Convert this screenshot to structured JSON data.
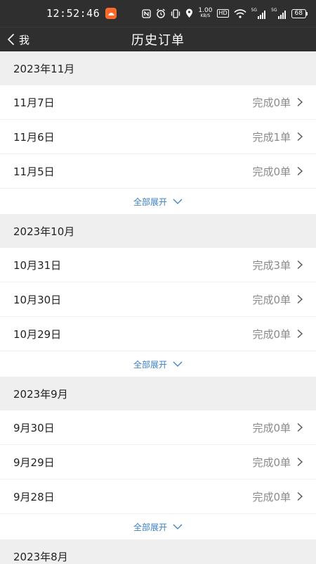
{
  "status_bar": {
    "time": "12:52:46",
    "net_speed_value": "1.00",
    "net_speed_unit": "KB/S",
    "hd_label": "HD",
    "sim1_label": "5G",
    "sim2_label": "5G",
    "battery": "68",
    "icons": [
      "app-notification-icon",
      "nfc-icon",
      "alarm-icon",
      "vibrate-icon",
      "location-icon",
      "wifi-icon",
      "signal-icon",
      "battery-icon"
    ]
  },
  "nav": {
    "back_label": "我",
    "title": "历史订单"
  },
  "expand_label": "全部展开",
  "months": [
    {
      "title": "2023年11月",
      "days": [
        {
          "date": "11月7日",
          "count": "完成0单"
        },
        {
          "date": "11月6日",
          "count": "完成1单"
        },
        {
          "date": "11月5日",
          "count": "完成0单"
        }
      ]
    },
    {
      "title": "2023年10月",
      "days": [
        {
          "date": "10月31日",
          "count": "完成3单"
        },
        {
          "date": "10月30日",
          "count": "完成0单"
        },
        {
          "date": "10月29日",
          "count": "完成0单"
        }
      ]
    },
    {
      "title": "2023年9月",
      "days": [
        {
          "date": "9月30日",
          "count": "完成0单"
        },
        {
          "date": "9月29日",
          "count": "完成0单"
        },
        {
          "date": "9月28日",
          "count": "完成0单"
        }
      ]
    },
    {
      "title": "2023年8月",
      "days": []
    }
  ],
  "colors": {
    "bar_bg": "#2f2f2f",
    "page_bg": "#efefef",
    "expand_link": "#3a7fc1",
    "count_text": "#8a8a8a"
  }
}
